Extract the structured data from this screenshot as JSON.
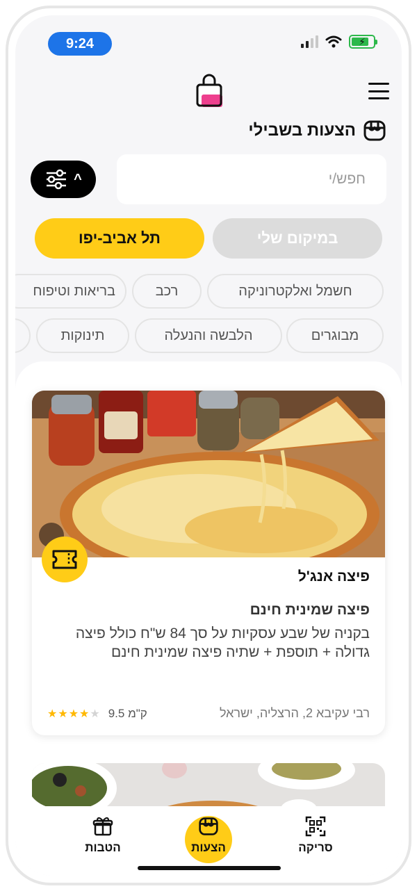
{
  "status_bar": {
    "time": "9:24"
  },
  "header": {
    "section_title": "הצעות בשבילי"
  },
  "search": {
    "placeholder": "חפש/י"
  },
  "location": {
    "my_location_label": "במיקום שלי",
    "city_label": "תל אביב-יפו"
  },
  "categories_row1": [
    "חשמל ואלקטרוניקה",
    "רכב",
    "בריאות וטיפוח"
  ],
  "categories_row2": [
    "מבוגרים",
    "הלבשה והנעלה",
    "תינוקות"
  ],
  "offers": [
    {
      "business_name": "פיצה אנג'ל",
      "title": "פיצה שמינית חינם",
      "description": "בקניה של שבע עסקיות על סך 84 ש\"ח כולל פיצה גדולה + תוספת + שתיה פיצה שמינית חינם",
      "address": "רבי עקיבא 2, הרצליה, ישראל",
      "distance": "9.5 ק\"מ",
      "rating": 4,
      "rating_max": 5
    }
  ],
  "bottom_nav": {
    "benefits": "הטבות",
    "offers": "הצעות",
    "scan": "סריקה"
  },
  "colors": {
    "accent": "#ffcc17",
    "time_pill": "#1d74e8",
    "brand_pink": "#ee3f8e"
  }
}
